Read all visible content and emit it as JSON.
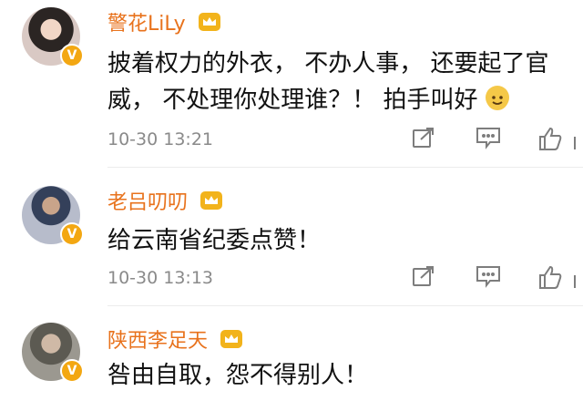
{
  "comments": [
    {
      "name": "警花LiLy",
      "text_line1": "披着权力的外衣， 不办人事， 还要起了官",
      "text_line2": "威， 不处理你处理谁？！ 拍手叫好",
      "time": "10-30 13:21"
    },
    {
      "name": "老吕叨叨",
      "text_line1": "给云南省纪委点赞！",
      "time": "10-30 13:13"
    },
    {
      "name": "陕西李足天",
      "text_line1": "咎由自取，怨不得别人！"
    }
  ],
  "verified_badge": "V",
  "icons": [
    "share-icon",
    "comment-icon",
    "like-icon",
    "crown-badge-icon",
    "clap-emoji-icon"
  ],
  "colors": {
    "name": "#e8721c",
    "verified": "#f3a712",
    "crown": "#f2b31b",
    "time": "#8a8a8a"
  }
}
